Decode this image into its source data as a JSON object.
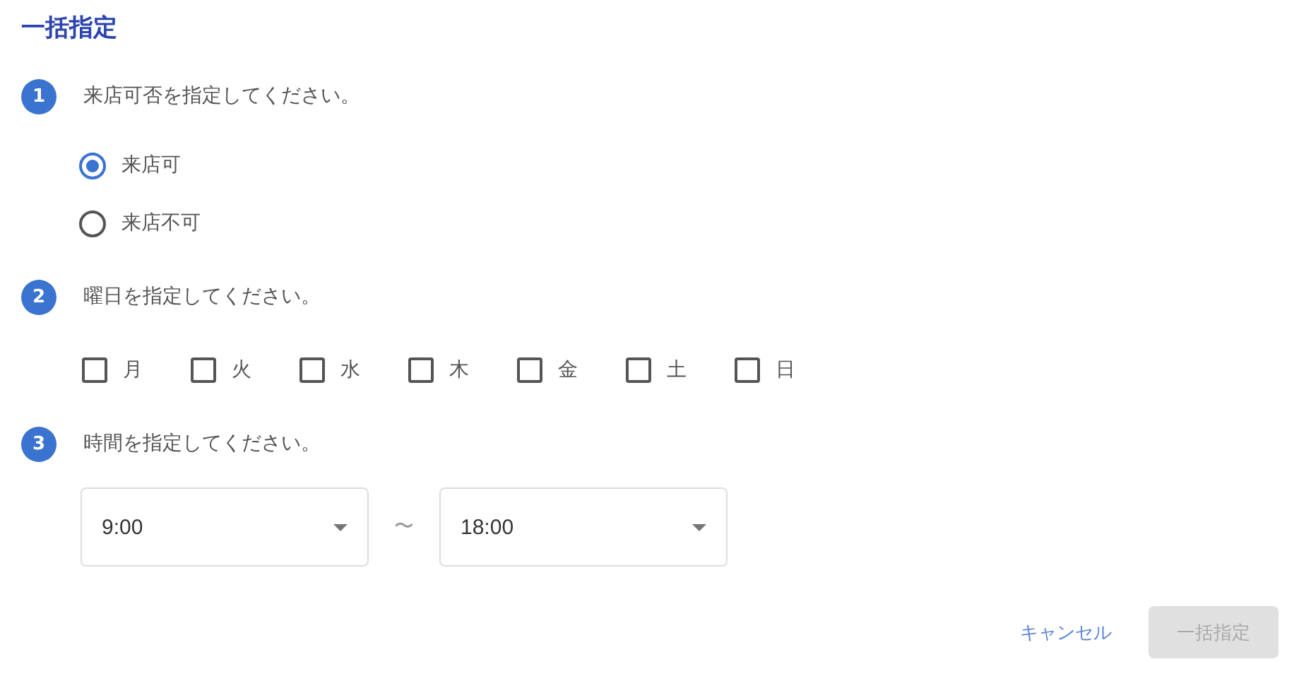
{
  "title": "一括指定",
  "steps": [
    {
      "number": "1",
      "label": "来店可否を指定してください。",
      "kind": "radio",
      "options": [
        {
          "label": "来店可",
          "selected": true
        },
        {
          "label": "来店不可",
          "selected": false
        }
      ]
    },
    {
      "number": "2",
      "label": "曜日を指定してください。",
      "kind": "checkbox",
      "options": [
        {
          "label": "月",
          "checked": false
        },
        {
          "label": "火",
          "checked": false
        },
        {
          "label": "水",
          "checked": false
        },
        {
          "label": "木",
          "checked": false
        },
        {
          "label": "金",
          "checked": false
        },
        {
          "label": "土",
          "checked": false
        },
        {
          "label": "日",
          "checked": false
        }
      ]
    },
    {
      "number": "3",
      "label": "時間を指定してください。",
      "kind": "time",
      "start": "9:00",
      "separator": "〜",
      "end": "18:00"
    }
  ],
  "buttons": [
    {
      "label": "キャンセル",
      "kind": "text"
    },
    {
      "label": "一括指定",
      "kind": "filled",
      "disabled": true
    }
  ]
}
